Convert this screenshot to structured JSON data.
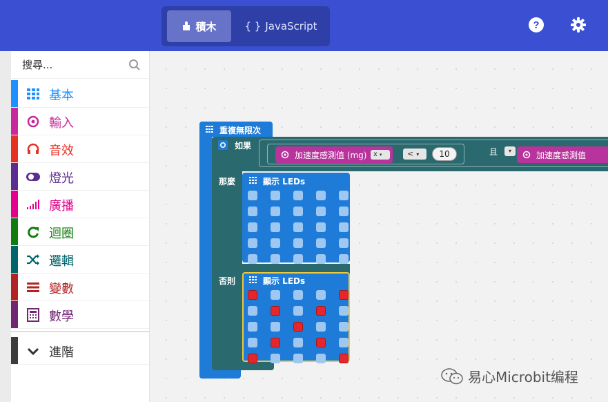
{
  "header": {
    "tab_blocks": "積木",
    "tab_js": "JavaScript",
    "tab_js_prefix": "{ }",
    "colors": {
      "bar": "#3a4fd1",
      "toggle": "#2e40a8",
      "toggle_active": "#6673c9"
    }
  },
  "sidebar": {
    "search_placeholder": "搜尋...",
    "categories": [
      {
        "label": "基本",
        "color": "#1e90ff",
        "icon": "grid-icon"
      },
      {
        "label": "輸入",
        "color": "#c8289b",
        "icon": "target-icon"
      },
      {
        "label": "音效",
        "color": "#e63022",
        "icon": "headphones-icon"
      },
      {
        "label": "燈光",
        "color": "#5c2d91",
        "icon": "toggle-icon"
      },
      {
        "label": "廣播",
        "color": "#e3008c",
        "icon": "signal-icon"
      },
      {
        "label": "迴圈",
        "color": "#107c10",
        "icon": "refresh-icon"
      },
      {
        "label": "邏輯",
        "color": "#00646b",
        "icon": "shuffle-icon"
      },
      {
        "label": "變數",
        "color": "#b22222",
        "icon": "list-icon"
      },
      {
        "label": "數學",
        "color": "#712672",
        "icon": "calculator-icon"
      },
      {
        "label": "進階",
        "color": "#3c3c3c",
        "icon": "chevron-down-icon"
      }
    ]
  },
  "workspace": {
    "forever_label": "重複無限次",
    "if_label": "如果",
    "then_label": "那麼",
    "else_label": "否則",
    "show_leds_label": "顯示 LEDs",
    "accel_label": "加速度感測值 (mg)",
    "accel_label_2": "加速度感測值",
    "axis": "x",
    "compare_op": "<",
    "compare_value": "10",
    "and_label": "且",
    "leds_then": [
      [
        0,
        0,
        0,
        0,
        0
      ],
      [
        0,
        0,
        0,
        0,
        0
      ],
      [
        0,
        0,
        0,
        0,
        0
      ],
      [
        0,
        0,
        0,
        0,
        0
      ],
      [
        0,
        0,
        0,
        0,
        0
      ]
    ],
    "leds_else": [
      [
        1,
        0,
        0,
        0,
        1
      ],
      [
        0,
        1,
        0,
        1,
        0
      ],
      [
        0,
        0,
        1,
        0,
        0
      ],
      [
        0,
        1,
        0,
        1,
        0
      ],
      [
        1,
        0,
        0,
        0,
        1
      ]
    ]
  },
  "watermark": "易心Microbit编程"
}
